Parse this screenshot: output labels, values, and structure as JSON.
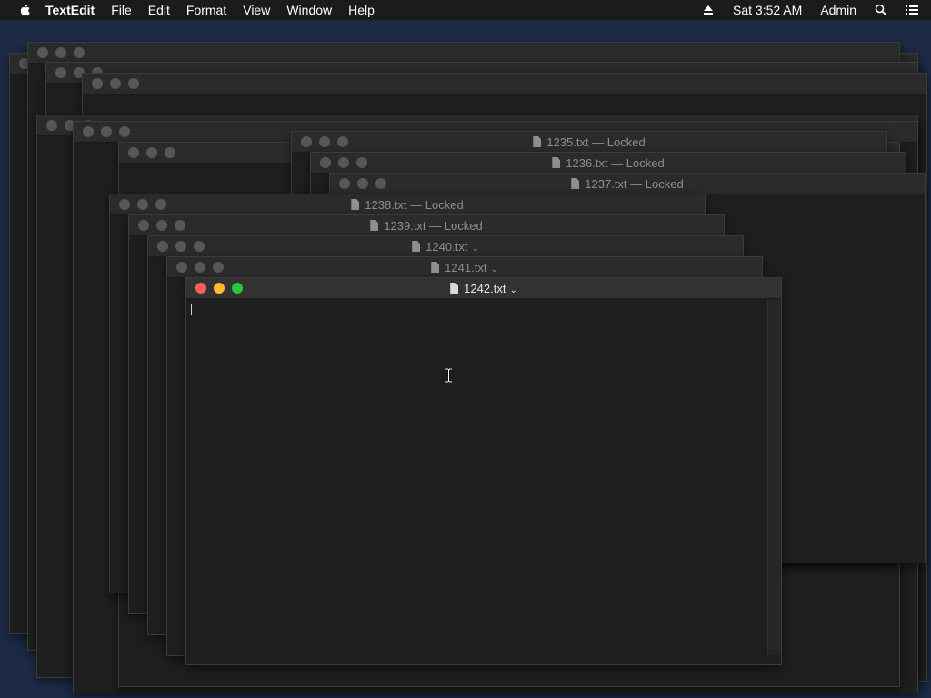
{
  "menubar": {
    "app": "TextEdit",
    "menus": [
      "File",
      "Edit",
      "Format",
      "View",
      "Window",
      "Help"
    ],
    "clock": "Sat 3:52 AM",
    "user": "Admin",
    "icons": [
      "apple-icon",
      "eject-icon",
      "search-icon",
      "list-icon"
    ]
  },
  "windows": [
    {
      "title": "1235.txt",
      "status": "Locked"
    },
    {
      "title": "1236.txt",
      "status": "Locked"
    },
    {
      "title": "1237.txt",
      "status": "Locked"
    },
    {
      "title": "1238.txt",
      "status": "Locked"
    },
    {
      "title": "1239.txt",
      "status": "Locked"
    },
    {
      "title": "1240.txt",
      "status": ""
    },
    {
      "title": "1241.txt",
      "status": ""
    },
    {
      "title": "1242.txt",
      "status": "",
      "active": true
    }
  ],
  "colors": {
    "close": "#fd5f57",
    "minimize": "#febb2e",
    "zoom": "#2ac840",
    "desktop": "#1c2a44"
  }
}
